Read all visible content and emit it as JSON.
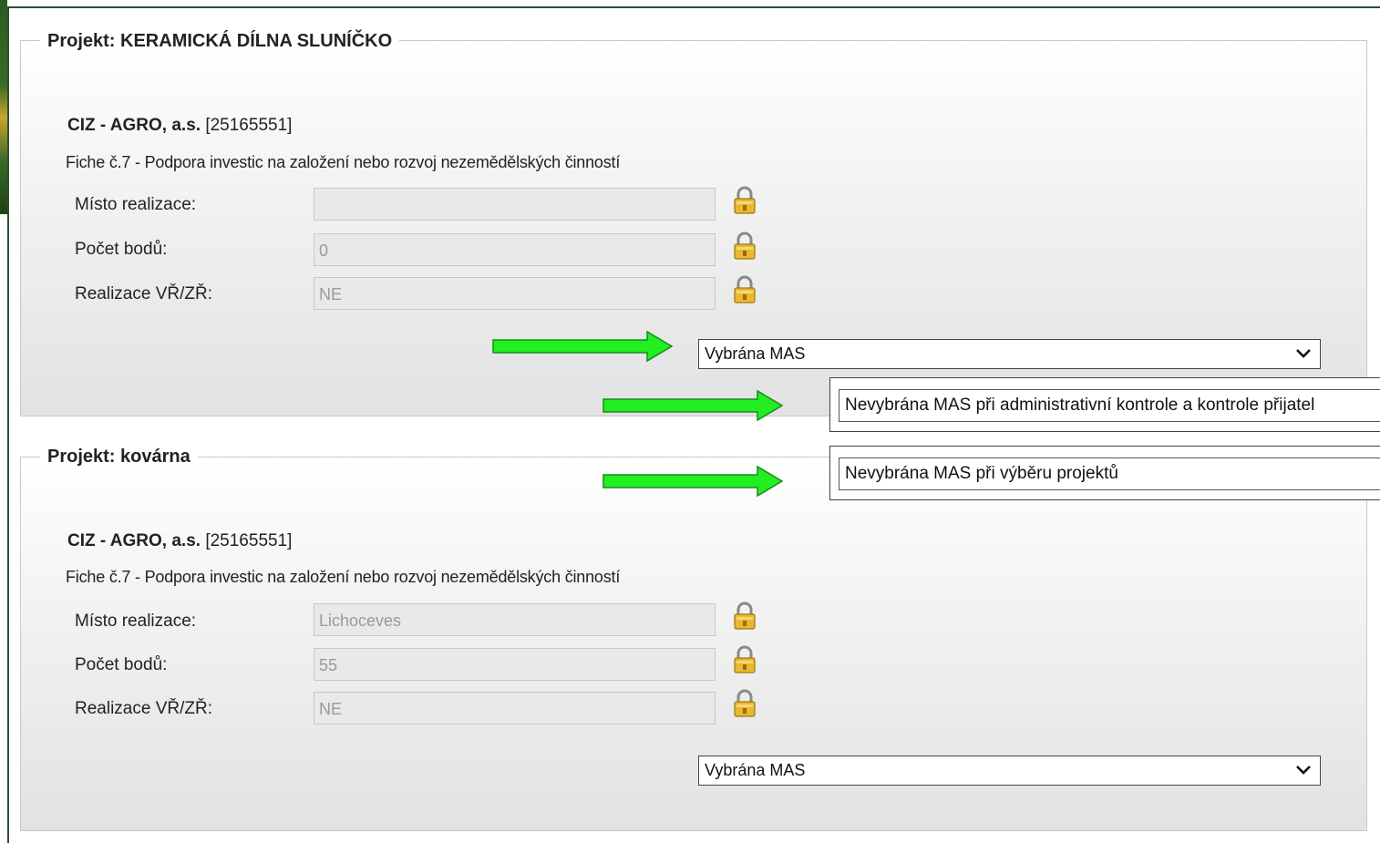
{
  "projects": [
    {
      "legend": "Projekt: KERAMICKÁ DÍLNA SLUNÍČKO",
      "company_name": "CIZ - AGRO, a.s.",
      "company_id": "[25165551]",
      "fiche": "Fiche č.7 - Podpora investic na založení nebo rozvoj nezemědělských činností",
      "fields": [
        {
          "label": "Místo realizace:",
          "value": ""
        },
        {
          "label": "Počet bodů:",
          "value": "0"
        },
        {
          "label": "Realizace VŘ/ZŘ:",
          "value": "NE"
        }
      ],
      "select_value": "Vybrána MAS"
    },
    {
      "legend": "Projekt: kovárna",
      "company_name": "CIZ - AGRO, a.s.",
      "company_id": "[25165551]",
      "fiche": "Fiche č.7 - Podpora investic na založení nebo rozvoj nezemědělských činností",
      "fields": [
        {
          "label": "Místo realizace:",
          "value": "Lichoceves"
        },
        {
          "label": "Počet bodů:",
          "value": "55"
        },
        {
          "label": "Realizace VŘ/ZŘ:",
          "value": "NE"
        }
      ],
      "select_value": "Vybrána MAS"
    }
  ],
  "dropdown_options": [
    "Nevybrána MAS při administrativní kontrole a kontrole přijatel",
    "Nevybrána MAS při výběru projektů"
  ],
  "icons": {
    "lock": "lock-icon",
    "chevron": "chevron-down-icon",
    "arrow": "green-arrow-icon"
  },
  "colors": {
    "arrow_fill": "#22ee22",
    "arrow_stroke": "#1a8a1a",
    "frame_border": "#2f4f2f"
  }
}
